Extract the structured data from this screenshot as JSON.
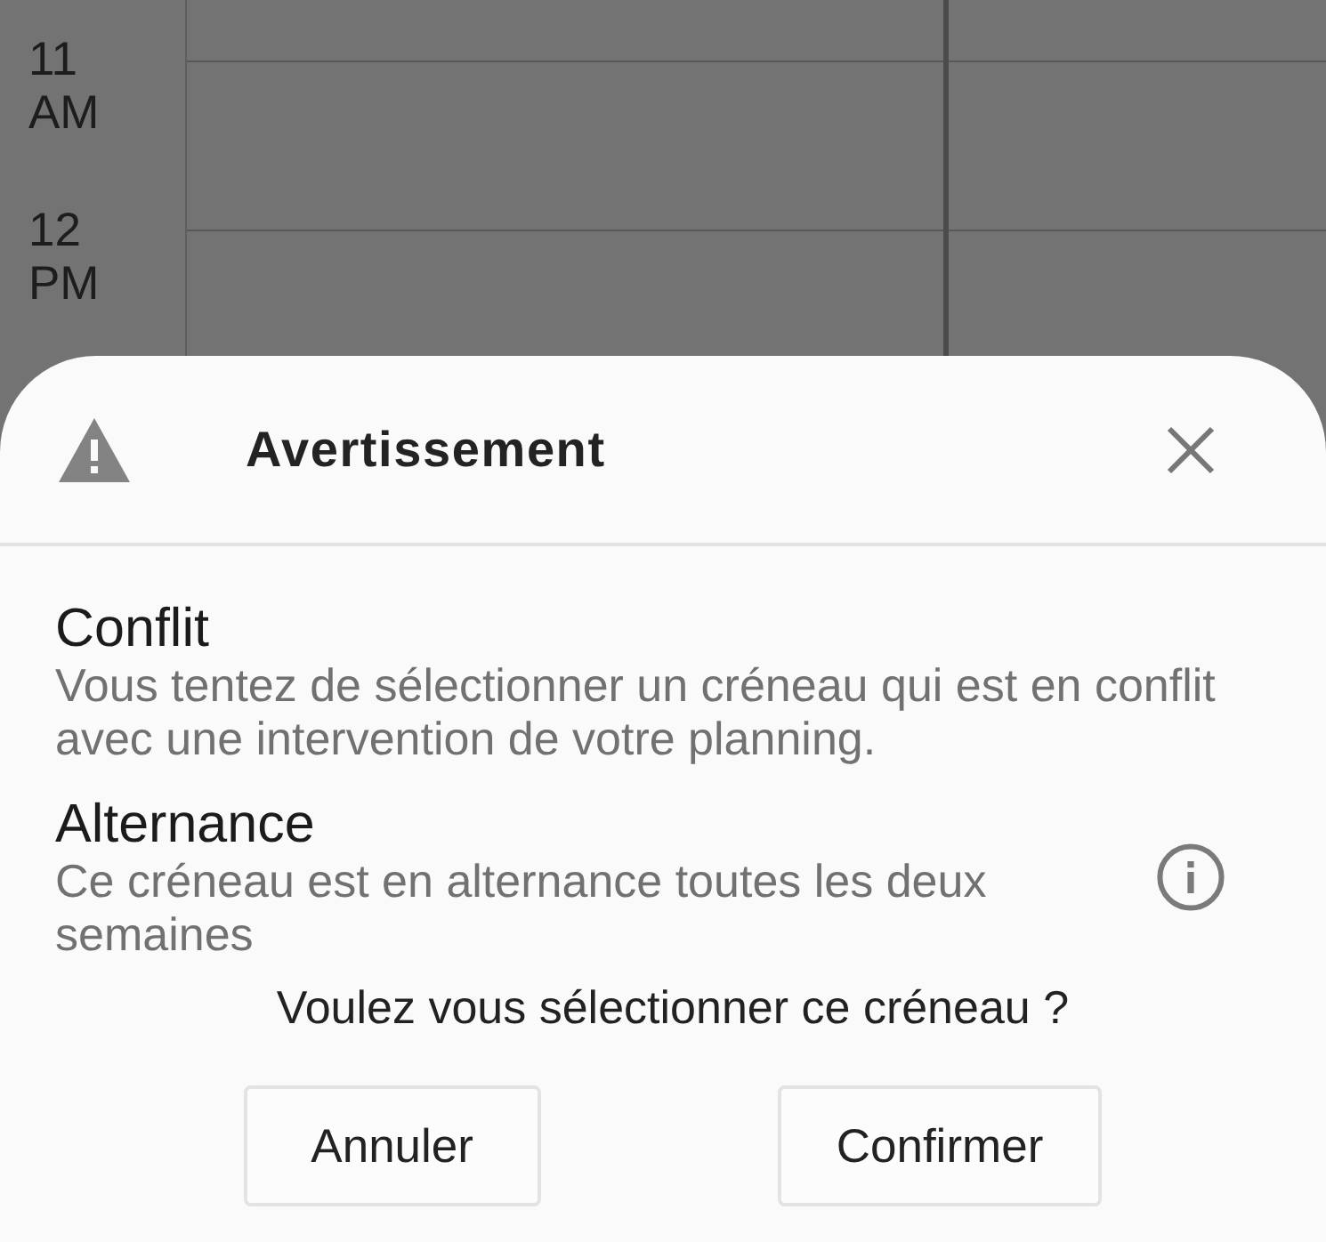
{
  "calendar": {
    "time_labels": [
      "11 AM",
      "12 PM"
    ]
  },
  "dialog": {
    "title": "Avertissement",
    "sections": [
      {
        "heading": "Conflit",
        "text": "Vous tentez de sélectionner un créneau qui est en conflit avec une intervention de votre planning.",
        "info_icon": false
      },
      {
        "heading": "Alternance",
        "text": "Ce créneau est en alternance toutes les deux semaines",
        "info_icon": true
      }
    ],
    "question": "Voulez vous sélectionner ce créneau ?",
    "buttons": [
      "Annuler",
      "Confirmer"
    ]
  }
}
